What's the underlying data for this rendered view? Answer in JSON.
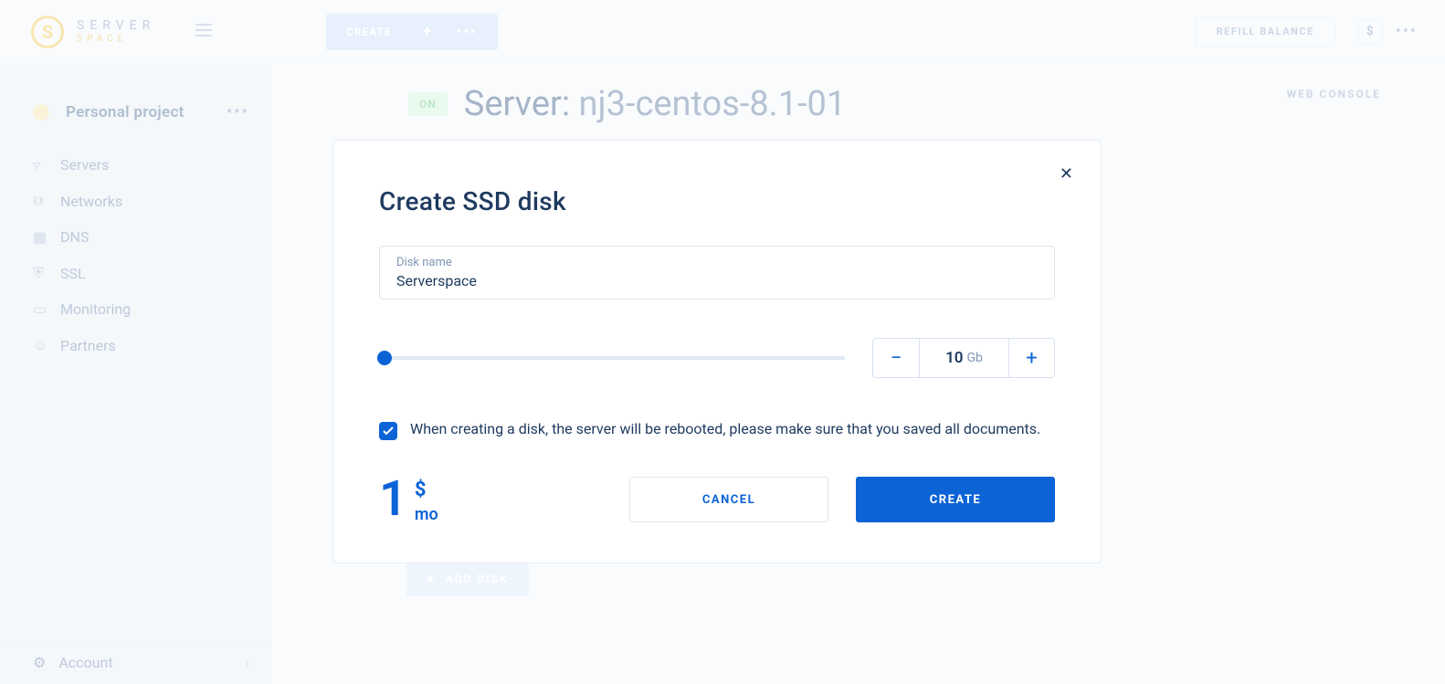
{
  "logo": {
    "brand_top": "SERVER",
    "brand_sub": "SPACE"
  },
  "topbar": {
    "create_label": "CREATE",
    "refill_label": "REFILL BALANCE",
    "currency_symbol": "$"
  },
  "sidebar": {
    "project_label": "Personal project",
    "items": [
      {
        "label": "Servers"
      },
      {
        "label": "Networks"
      },
      {
        "label": "DNS"
      },
      {
        "label": "SSL"
      },
      {
        "label": "Monitoring"
      },
      {
        "label": "Partners"
      }
    ],
    "account_label": "Account"
  },
  "server": {
    "status": "ON",
    "title_prefix": "Server:",
    "name": "nj3-centos-8.1-01",
    "web_console_label": "WEB CONSOLE",
    "add_disk_label": "ADD DISK"
  },
  "modal": {
    "title": "Create SSD disk",
    "disk_name_label": "Disk name",
    "disk_name_value": "Serverspace",
    "size_value": "10",
    "size_unit": "Gb",
    "consent_text": "When creating a disk, the server will be rebooted, please make sure that you saved all documents.",
    "consent_checked": true,
    "price_amount": "1",
    "price_currency": "$",
    "price_period": "mo",
    "cancel_label": "CANCEL",
    "create_label": "CREATE"
  }
}
